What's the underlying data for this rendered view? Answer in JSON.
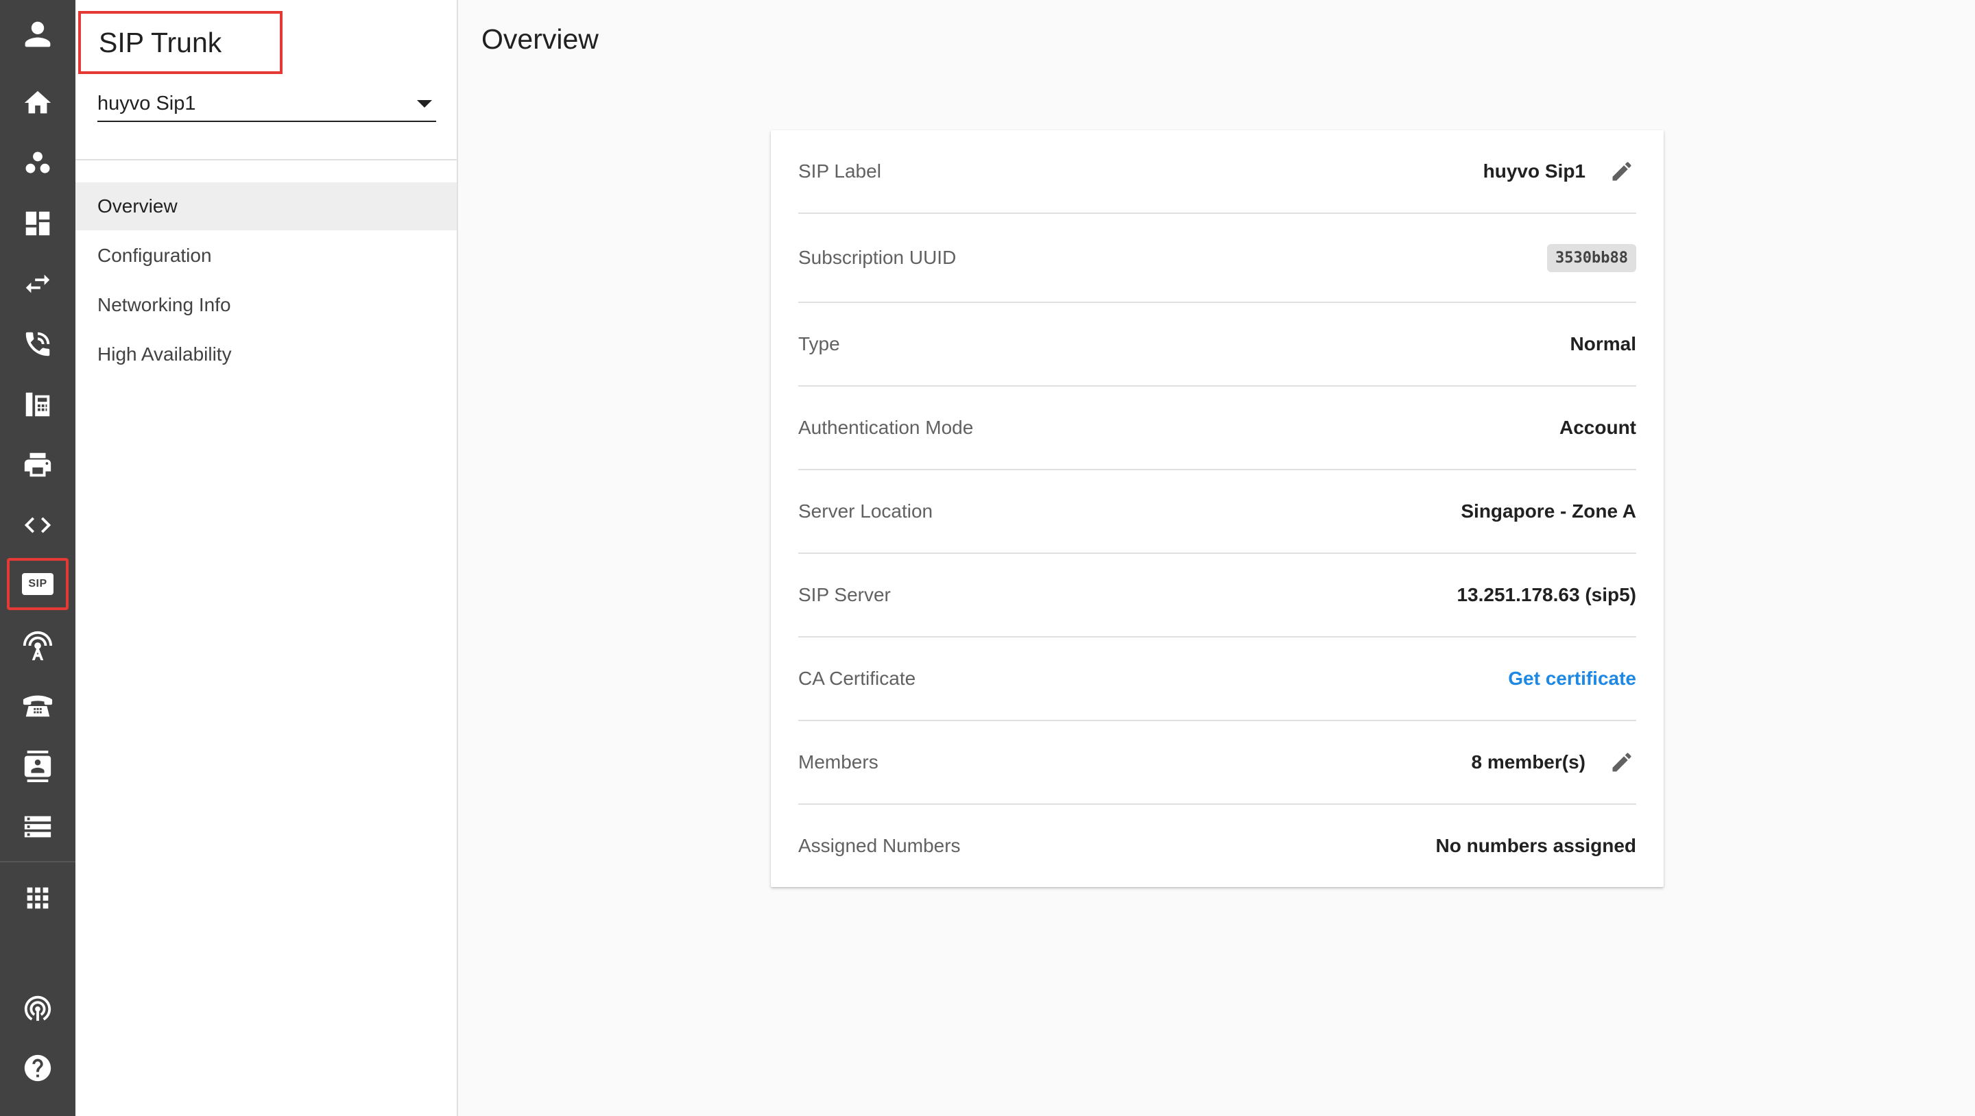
{
  "rail": {
    "items": [
      {
        "name": "profile-icon"
      },
      {
        "name": "home-icon"
      },
      {
        "name": "groups-icon"
      },
      {
        "name": "dashboard-icon"
      },
      {
        "name": "transfer-arrows-icon"
      },
      {
        "name": "phone-call-icon"
      },
      {
        "name": "desk-phone-icon"
      },
      {
        "name": "printer-icon"
      },
      {
        "name": "code-icon"
      },
      {
        "name": "sip-icon",
        "label": "SIP"
      },
      {
        "name": "wireless-tower-icon"
      },
      {
        "name": "telephone-icon"
      },
      {
        "name": "contacts-icon"
      },
      {
        "name": "list-icon"
      },
      {
        "name": "apps-grid-icon"
      },
      {
        "name": "podcast-antenna-icon"
      },
      {
        "name": "help-icon"
      }
    ]
  },
  "panel": {
    "title": "SIP Trunk",
    "selected_trunk": "huyvo Sip1",
    "nav": [
      {
        "label": "Overview",
        "active": true
      },
      {
        "label": "Configuration",
        "active": false
      },
      {
        "label": "Networking Info",
        "active": false
      },
      {
        "label": "High Availability",
        "active": false
      }
    ]
  },
  "main": {
    "title": "Overview",
    "rows": [
      {
        "label": "SIP Label",
        "value": "huyvo Sip1",
        "editable": true
      },
      {
        "label": "Subscription UUID",
        "value": "3530bb88",
        "chip": true
      },
      {
        "label": "Type",
        "value": "Normal"
      },
      {
        "label": "Authentication Mode",
        "value": "Account"
      },
      {
        "label": "Server Location",
        "value": "Singapore - Zone A"
      },
      {
        "label": "SIP Server",
        "value": "13.251.178.63 (sip5)"
      },
      {
        "label": "CA Certificate",
        "value": "Get certificate",
        "link": true
      },
      {
        "label": "Members",
        "value": "8 member(s)",
        "editable": true
      },
      {
        "label": "Assigned Numbers",
        "value": "No numbers assigned"
      }
    ]
  },
  "colors": {
    "rail_bg": "#424242",
    "highlight": "#e53935",
    "link": "#1e88e5"
  }
}
